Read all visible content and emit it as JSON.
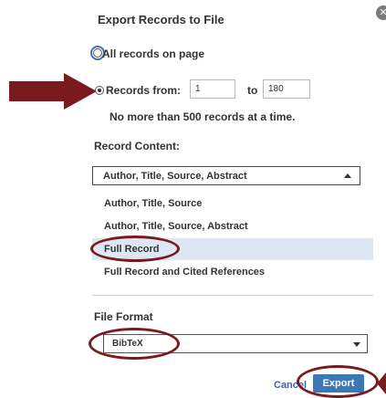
{
  "dialog": {
    "title": "Export Records to File",
    "close_icon": "close-icon"
  },
  "records": {
    "all_records_label": "All records on page",
    "records_from_label": "Records from:",
    "from_value": "1",
    "to_label": "to",
    "to_value": "180",
    "limit_note": "No more than 500 records at a time.",
    "selected_option": "records-from"
  },
  "record_content": {
    "label": "Record Content:",
    "selected": "Author, Title, Source, Abstract",
    "options": [
      "Author, Title, Source",
      "Author, Title, Source, Abstract",
      "Full Record",
      "Full Record and Cited References"
    ],
    "highlighted_index": 2
  },
  "file_format": {
    "label": "File Format",
    "selected": "BibTeX"
  },
  "actions": {
    "cancel_label": "Cancel",
    "export_label": "Export"
  },
  "colors": {
    "annotation": "#7a1a1f",
    "export_button": "#3c78b5",
    "highlight_row": "#dde7f3"
  }
}
